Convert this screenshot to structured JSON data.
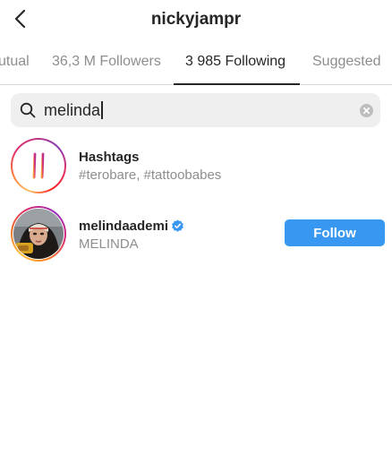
{
  "header": {
    "title": "nickyjampr"
  },
  "tabs": [
    {
      "label": "utual",
      "active": false
    },
    {
      "label": "36,3 M Followers",
      "active": false
    },
    {
      "label": "3 985 Following",
      "active": true
    },
    {
      "label": "Suggested",
      "active": false
    }
  ],
  "search": {
    "query": "melinda",
    "icon": "search-icon"
  },
  "results": {
    "hashtags": {
      "title": "Hashtags",
      "subtitle": "#terobare, #tattoobabes",
      "icon": "hashtag-icon"
    },
    "user": {
      "username": "melindaademi",
      "full_name": "MELINDA",
      "verified": true,
      "follow_label": "Follow"
    }
  },
  "colors": {
    "accent": "#3897f0",
    "secondary_text": "#8e8e8e",
    "primary_text": "#262626"
  }
}
